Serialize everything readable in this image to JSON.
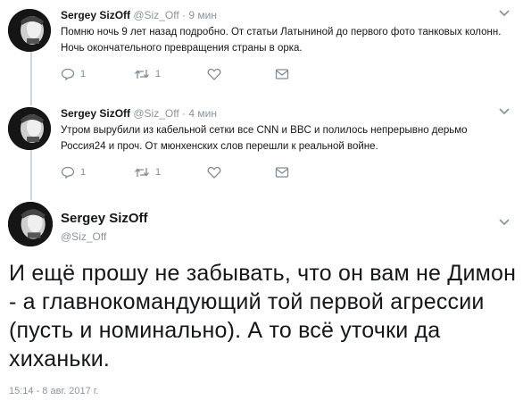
{
  "tweets": [
    {
      "name": "Sergey SizOff",
      "handle": "@Siz_Off",
      "time": "· 9 мин",
      "text": "Помню ночь 9 лет назад подробно. От статьи Латыниной до первого фото танковых колонн. Ночь окончательного превращения страны в орка.",
      "replies": "1",
      "retweets": "1"
    },
    {
      "name": "Sergey SizOff",
      "handle": "@Siz_Off",
      "time": "· 4 мин",
      "text": "Утром вырубили из кабельной сетки все CNN и BBC и полилось непрерывно дерьмо Россия24 и проч.  От мюнхенских слов перешли к реальной войне.",
      "replies": "1",
      "retweets": "1"
    }
  ],
  "main": {
    "name": "Sergey SizOff",
    "handle": "@Siz_Off",
    "text": "И ещё прошу не забывать, что он вам не Димон - а главнокомандующий той первой агрессии (пусть и номинально). А то всё уточки да хиханьки.",
    "timestamp": "15:14 - 8 авг. 2017 г."
  },
  "colors": {
    "muted": "#8a959e",
    "thread": "#ccd6dd",
    "text": "#14171a"
  },
  "icons": [
    "reply-icon",
    "retweet-icon",
    "like-icon",
    "dm-icon",
    "chevron-down-icon"
  ]
}
